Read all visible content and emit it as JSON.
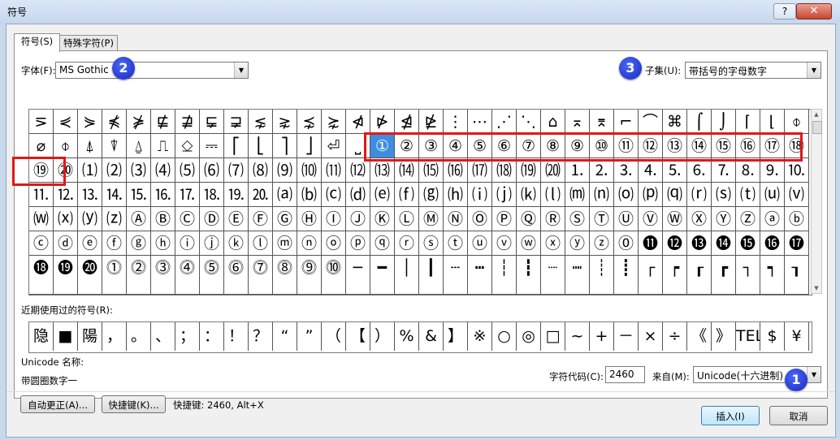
{
  "window": {
    "title": "符号",
    "help": "?",
    "close": "✕"
  },
  "tabs": [
    "符号(S)",
    "特殊字符(P)"
  ],
  "font": {
    "label": "字体(F):",
    "value": "MS Gothic"
  },
  "subset": {
    "label": "子集(U):",
    "value": "带括号的字母数字"
  },
  "badges": [
    "1",
    "2",
    "3"
  ],
  "symbol_rows": [
    [
      "⋝",
      "⋞",
      "⋟",
      "⋠",
      "⋡",
      "⋢",
      "⋣",
      "⋤",
      "⋥",
      "⋦",
      "⋧",
      "⋨",
      "⋩",
      "⋪",
      "⋫",
      "⋬",
      "⋭",
      "⋮",
      "⋯",
      "⋰",
      "⋱",
      "⌂",
      "⌅",
      "⌆",
      "⌐",
      "⌒",
      "⌘",
      "⌠",
      "⌡",
      "⌈",
      "⌊",
      "⌽"
    ],
    [
      "⌀",
      "⌽",
      "⍋",
      "⍒",
      "⍙",
      "⎍",
      "⎐",
      "⎓",
      "⎡",
      "⎣",
      "⎤",
      "⎦",
      "⏎",
      "⎵",
      "①",
      "②",
      "③",
      "④",
      "⑤",
      "⑥",
      "⑦",
      "⑧",
      "⑨",
      "⑩",
      "⑪",
      "⑫",
      "⑬",
      "⑭",
      "⑮",
      "⑯",
      "⑰",
      "⑱"
    ],
    [
      "⑲",
      "⑳",
      "⑴",
      "⑵",
      "⑶",
      "⑷",
      "⑸",
      "⑹",
      "⑺",
      "⑻",
      "⑼",
      "⑽",
      "⑾",
      "⑿",
      "⒀",
      "⒁",
      "⒂",
      "⒃",
      "⒄",
      "⒅",
      "⒆",
      "⒇",
      "⒈",
      "⒉",
      "⒊",
      "⒋",
      "⒌",
      "⒍",
      "⒎",
      "⒏",
      "⒐",
      "⒑"
    ],
    [
      "⒒",
      "⒓",
      "⒔",
      "⒕",
      "⒖",
      "⒗",
      "⒘",
      "⒙",
      "⒚",
      "⒛",
      "⒜",
      "⒝",
      "⒞",
      "⒟",
      "⒠",
      "⒡",
      "⒢",
      "⒣",
      "⒤",
      "⒥",
      "⒦",
      "⒧",
      "⒨",
      "⒩",
      "⒪",
      "⒫",
      "⒬",
      "⒭",
      "⒮",
      "⒯",
      "⒰",
      "⒱"
    ],
    [
      "⒲",
      "⒳",
      "⒴",
      "⒵",
      "Ⓐ",
      "Ⓑ",
      "Ⓒ",
      "Ⓓ",
      "Ⓔ",
      "Ⓕ",
      "Ⓖ",
      "Ⓗ",
      "Ⓘ",
      "Ⓙ",
      "Ⓚ",
      "Ⓛ",
      "Ⓜ",
      "Ⓝ",
      "Ⓞ",
      "Ⓟ",
      "Ⓠ",
      "Ⓡ",
      "Ⓢ",
      "Ⓣ",
      "Ⓤ",
      "Ⓥ",
      "Ⓦ",
      "Ⓧ",
      "Ⓨ",
      "Ⓩ",
      "ⓐ",
      "ⓑ"
    ],
    [
      "ⓒ",
      "ⓓ",
      "ⓔ",
      "ⓕ",
      "ⓖ",
      "ⓗ",
      "ⓘ",
      "ⓙ",
      "ⓚ",
      "ⓛ",
      "ⓜ",
      "ⓝ",
      "ⓞ",
      "ⓟ",
      "ⓠ",
      "ⓡ",
      "ⓢ",
      "ⓣ",
      "ⓤ",
      "ⓥ",
      "ⓦ",
      "ⓧ",
      "ⓨ",
      "ⓩ",
      "⓪",
      "⓫",
      "⓬",
      "⓭",
      "⓮",
      "⓯",
      "⓰",
      "⓱"
    ],
    [
      "⓲",
      "⓳",
      "⓴",
      "⓵",
      "⓶",
      "⓷",
      "⓸",
      "⓹",
      "⓺",
      "⓻",
      "⓼",
      "⓽",
      "⓾",
      "─",
      "━",
      "│",
      "┃",
      "┄",
      "┅",
      "┆",
      "┇",
      "┈",
      "┉",
      "┊",
      "┋",
      "┌",
      "┍",
      "┎",
      "┏",
      "┐",
      "┑",
      "┒"
    ]
  ],
  "selected_symbol": "①",
  "recent": {
    "label": "近期使用过的符号(R):",
    "items": [
      "隐",
      "■",
      "陽",
      "，",
      "。",
      "、",
      "；",
      "：",
      "！",
      "？",
      "“",
      "”",
      "（",
      "【",
      "）",
      "%",
      "&",
      "】",
      "※",
      "○",
      "◎",
      "□",
      "~",
      "+",
      "－",
      "×",
      "÷",
      "《",
      "》",
      "TEL",
      "$",
      "¥"
    ]
  },
  "unicode_name": {
    "label": "Unicode 名称:",
    "value": "带圆圈数字一"
  },
  "charcode": {
    "label": "字符代码(C):",
    "value": "2460"
  },
  "from": {
    "label": "来自(M):",
    "value": "Unicode(十六进制)"
  },
  "buttons": {
    "autocorrect": "自动更正(A)...",
    "shortcut": "快捷键(K)...",
    "insert": "插入(I)",
    "cancel": "取消"
  },
  "shortcut_text": "快捷键: 2460, Alt+X",
  "colors": {
    "highlight": "#e01818",
    "selected": "#3e8ee0",
    "badge": "#1a28c9"
  }
}
